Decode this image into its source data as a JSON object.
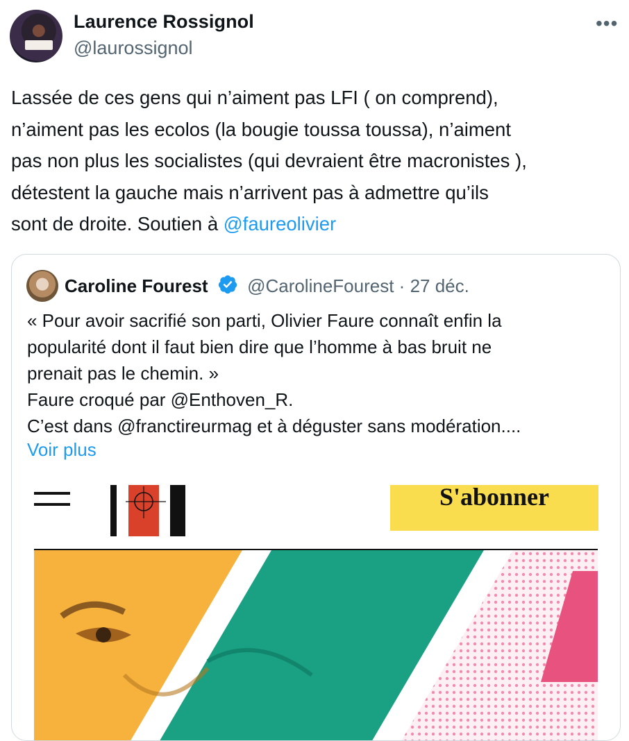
{
  "author": {
    "name": "Laurence Rossignol",
    "handle": "@laurossignol"
  },
  "more_label": "•••",
  "tweet": {
    "text_lines": [
      "Lassée de ces gens qui n’aiment  pas LFI ( on comprend),",
      "n’aiment pas les ecolos (la bougie toussa toussa), n’aiment",
      "pas non plus les socialistes (qui devraient être macronistes ),",
      "détestent la gauche mais n’arrivent pas à admettre qu’ils",
      "sont de droite. Soutien à "
    ],
    "mention": "@faureolivier"
  },
  "quoted": {
    "name": "Caroline Fourest",
    "handle": "@CarolineFourest",
    "separator": "·",
    "date": "27 déc.",
    "text_lines": [
      "« Pour avoir sacrifié son parti, Olivier Faure connaît enfin la",
      "popularité dont il faut bien dire que l’homme à bas bruit ne",
      "prenait pas le chemin. »",
      "Faure croqué par @Enthoven_R.",
      "C’est dans @franctireurmag et à déguster sans modération...."
    ],
    "show_more": "Voir plus"
  },
  "media": {
    "subscribe_label": "S'abonner",
    "logo_colors": [
      "#111111",
      "#d9412b",
      "#111111"
    ],
    "art_colors": [
      "#f6b23c",
      "#ffffff",
      "#1aa083",
      "#f7b9cf",
      "#e8527e"
    ]
  },
  "colors": {
    "link": "#1d9bf0",
    "secondary_text": "#536471",
    "verified": "#1d9bf0"
  }
}
